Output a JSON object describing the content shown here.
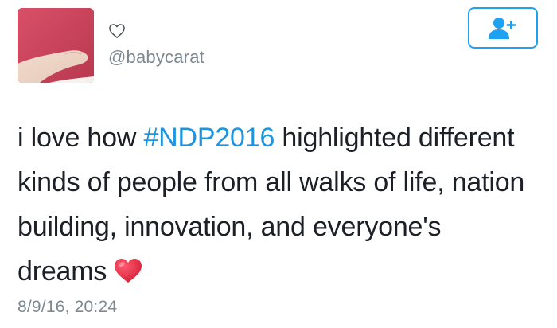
{
  "tweet": {
    "avatar_icon": "profile-photo",
    "like_icon": "heart-outline-icon",
    "handle": "@babycarat",
    "follow_icon": "add-user-icon",
    "text_before": "i love how ",
    "hashtag": "#NDP2016",
    "text_after": " highlighted different kinds of people from all walks of life, nation building, innovation, and everyone's dreams",
    "emoji": "red-heart-emoji",
    "timestamp": "8/9/16, 20:24"
  },
  "colors": {
    "accent": "#1da1f2",
    "hashtag": "#1b95e0",
    "muted_text": "#7d8891",
    "body_text": "#1c2026",
    "heart_red": "#e0243c"
  }
}
